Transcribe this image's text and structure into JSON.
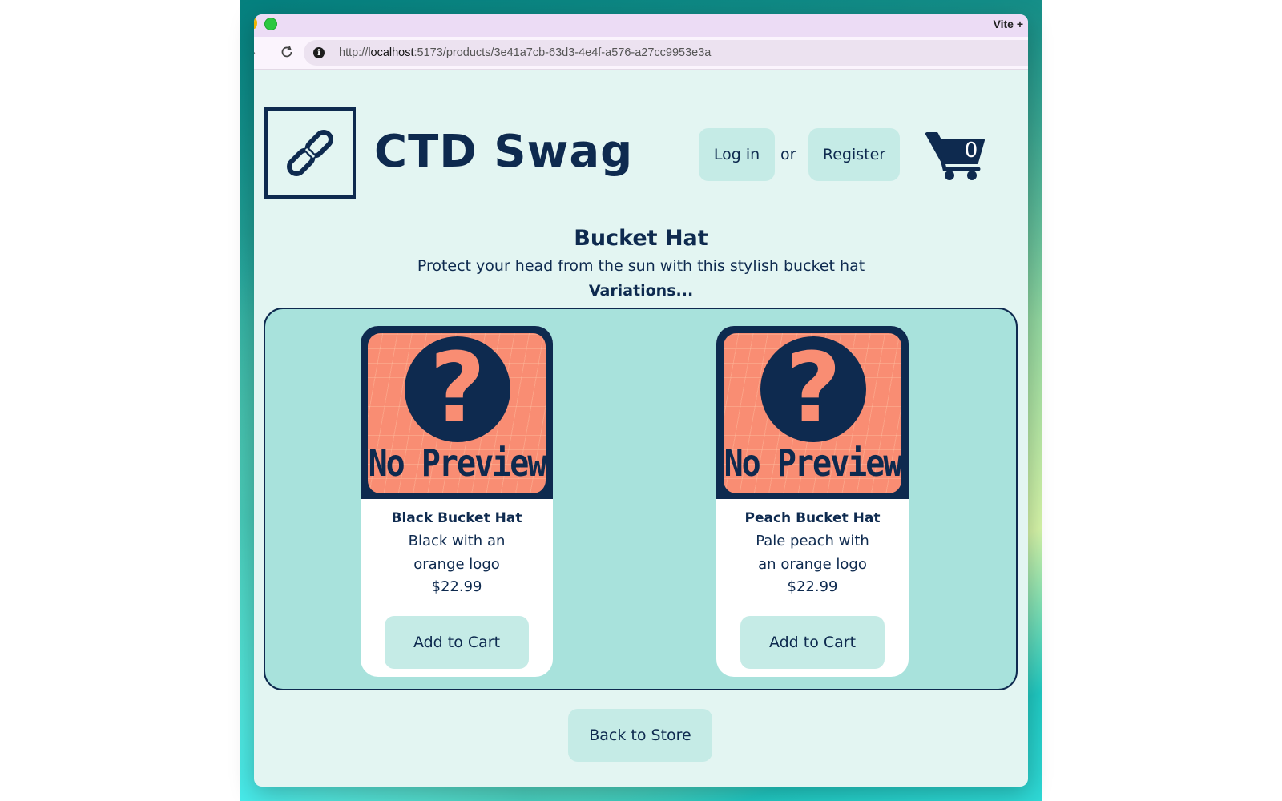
{
  "browser": {
    "tab_title": "Vite +",
    "url_prefix": "http://",
    "url_host": "localhost",
    "url_rest": ":5173/products/3e41a7cb-63d3-4e4f-a576-a27cc9953e3a"
  },
  "header": {
    "brand": "CTD Swag",
    "login_label": "Log in",
    "or_text": "or",
    "register_label": "Register",
    "cart_count": "0"
  },
  "product": {
    "title": "Bucket Hat",
    "description": "Protect your head from the sun with this stylish bucket hat",
    "variations_label": "Variations..."
  },
  "variations": [
    {
      "image_label": "No Preview",
      "name": "Black Bucket Hat",
      "description": "Black with an orange logo",
      "price": "$22.99",
      "button": "Add to Cart"
    },
    {
      "image_label": "No Preview",
      "name": "Peach Bucket Hat",
      "description": "Pale peach with an orange logo",
      "price": "$22.99",
      "button": "Add to Cart"
    }
  ],
  "footer": {
    "back_label": "Back to Store"
  },
  "colors": {
    "navy": "#0e2a4f",
    "page_bg": "#e3f5f2",
    "button_bg": "#c5ebe6",
    "variations_bg": "#a8e2dc",
    "placeholder_orange": "#f98d73"
  },
  "icons": [
    "info-icon",
    "reload-icon",
    "forward-icon",
    "link-logo-icon",
    "cart-icon",
    "question-mark-icon"
  ]
}
